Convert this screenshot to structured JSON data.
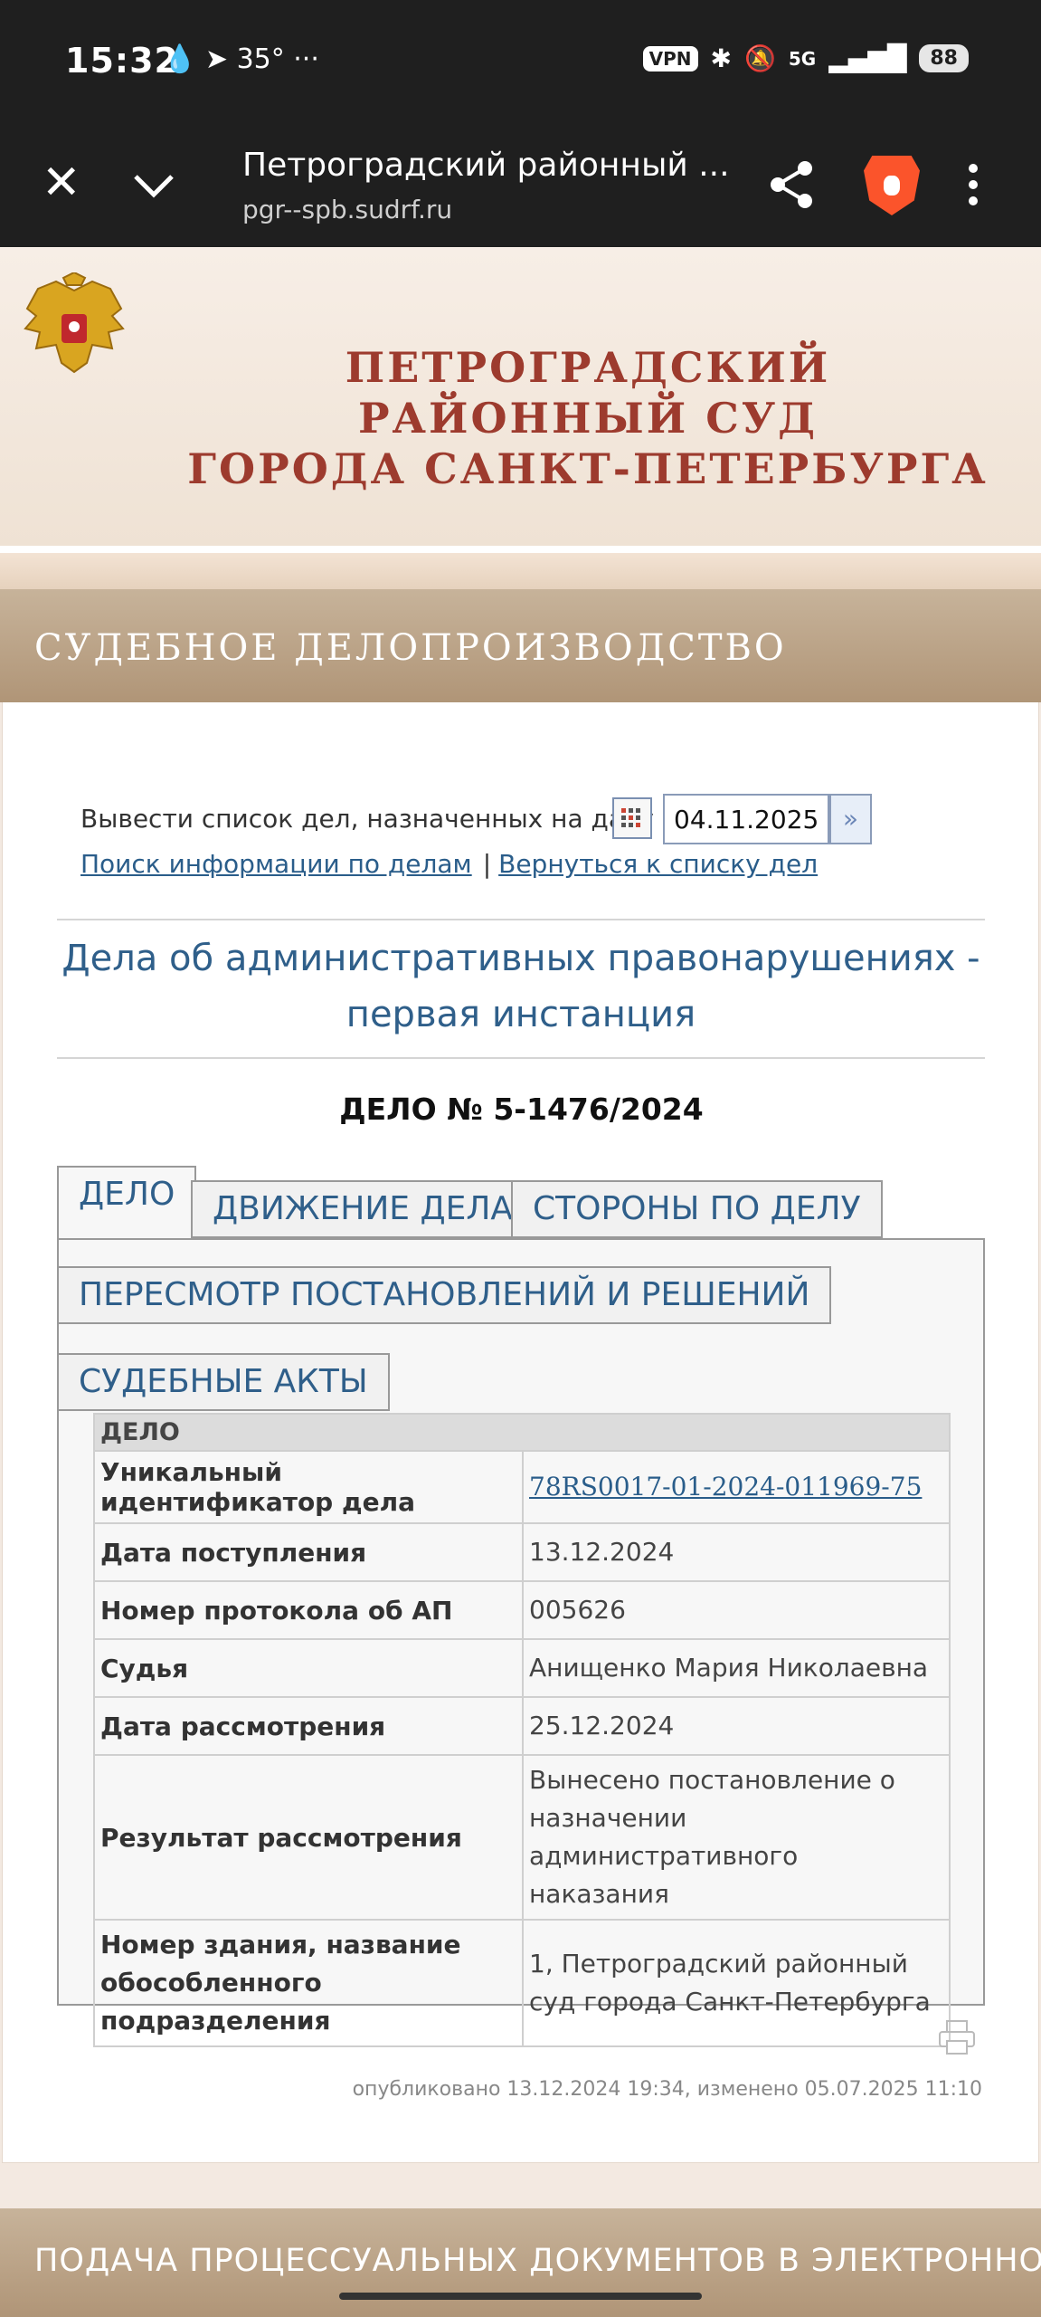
{
  "status_bar": {
    "time": "15:32",
    "left_icons": "💧 ➤ 35° ···",
    "vpn": "VPN",
    "network": "5G",
    "battery": "88"
  },
  "browser": {
    "page_title": "Петроградский районный ...",
    "url": "pgr--spb.sudrf.ru",
    "close_icon": "close-icon",
    "dropdown_icon": "chevron-down-icon",
    "share_icon": "share-icon",
    "menu_icon": "more-vertical-icon"
  },
  "header": {
    "court_name_line1": "ПЕТРОГРАДСКИЙ РАЙОННЫЙ СУД",
    "court_name_line2": "ГОРОДА САНКТ-ПЕТЕРБУРГА"
  },
  "section": {
    "title": "СУДЕБНОЕ ДЕЛОПРОИЗВОДСТВО"
  },
  "date_filter": {
    "label": "Вывести список дел, назначенных на дату",
    "value": "04.11.2025",
    "search_link": "Поиск информации по делам",
    "separator": "|",
    "back_link": "Вернуться к списку дел"
  },
  "category_title": "Дела об административных правонарушениях - первая инстанция",
  "case_number": "ДЕЛО № 5-1476/2024",
  "tabs": [
    {
      "label": "ДЕЛО",
      "active": true
    },
    {
      "label": "ДВИЖЕНИЕ ДЕЛА",
      "active": false
    },
    {
      "label": "СТОРОНЫ ПО ДЕЛУ",
      "active": false
    },
    {
      "label": "ПЕРЕСМОТР ПОСТАНОВЛЕНИЙ И РЕШЕНИЙ",
      "active": false
    },
    {
      "label": "СУДЕБНЫЕ АКТЫ",
      "active": false
    }
  ],
  "case_table": {
    "header": "ДЕЛО",
    "rows": [
      {
        "key": "Уникальный идентификатор дела",
        "value": "78RS0017-01-2024-011969-75"
      },
      {
        "key": "Дата поступления",
        "value": "13.12.2024"
      },
      {
        "key": "Номер протокола об АП",
        "value": "005626"
      },
      {
        "key": "Судья",
        "value": "Анищенко Мария Николаевна"
      },
      {
        "key": "Дата рассмотрения",
        "value": "25.12.2024"
      },
      {
        "key": "Результат рассмотрения",
        "value": "Вынесено постановление о назначении административного наказания"
      },
      {
        "key": "Номер здания, название обособленного подразделения",
        "value": "1, Петроградский районный суд города Санкт-Петербурга"
      }
    ]
  },
  "published": "опубликовано 13.12.2024 19:34, изменено 05.07.2025 11:10",
  "bottom_section": "ПОДАЧА ПРОЦЕССУАЛЬНЫХ ДОКУМЕНТОВ В ЭЛЕКТРОННОМ",
  "colors": {
    "court_red": "#9d3b2e",
    "link_blue": "#2f5f8a",
    "section_brown": "#b09577"
  }
}
